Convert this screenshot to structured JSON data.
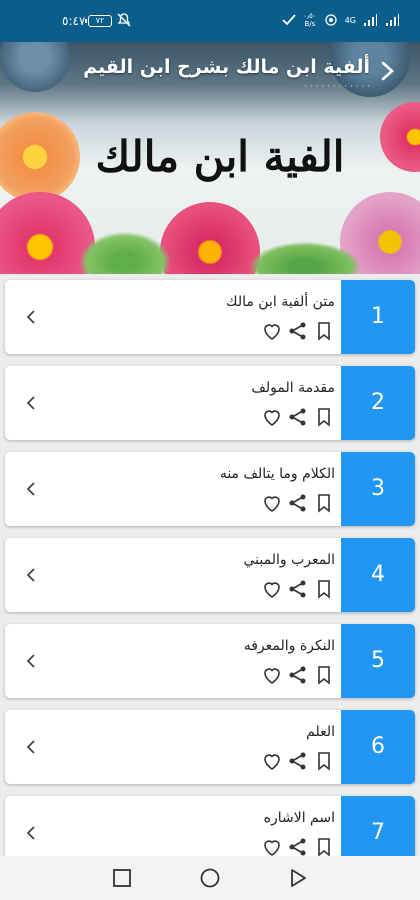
{
  "status_bar": {
    "time": "٥:٤٧",
    "battery": "٧٢",
    "network_speed_value": "٠٫٥٠",
    "network_speed_unit": "B/s",
    "signal_label": "4G"
  },
  "header": {
    "title": "ألفية ابن مالك بشرح ابن القيم",
    "subtitle": "· · · · · · · · · · · ·",
    "book_title": "الفية ابن مالك"
  },
  "chapters": [
    {
      "number": "1",
      "title": "متن ألفية ابن مالك"
    },
    {
      "number": "2",
      "title": "مقدمة المولف"
    },
    {
      "number": "3",
      "title": "الكلام وما يتالف منه"
    },
    {
      "number": "4",
      "title": "المعرب والمبني"
    },
    {
      "number": "5",
      "title": "النكرة والمعرفه"
    },
    {
      "number": "6",
      "title": "العلم"
    },
    {
      "number": "7",
      "title": "اسم الاشاره"
    }
  ],
  "colors": {
    "status_bar": "#0b5d8c",
    "accent": "#2196f3",
    "background": "#ececec"
  },
  "icons": {
    "favorite": "heart-outline-icon",
    "share": "share-icon",
    "bookmark": "bookmark-outline-icon",
    "open": "chevron-left-icon"
  }
}
